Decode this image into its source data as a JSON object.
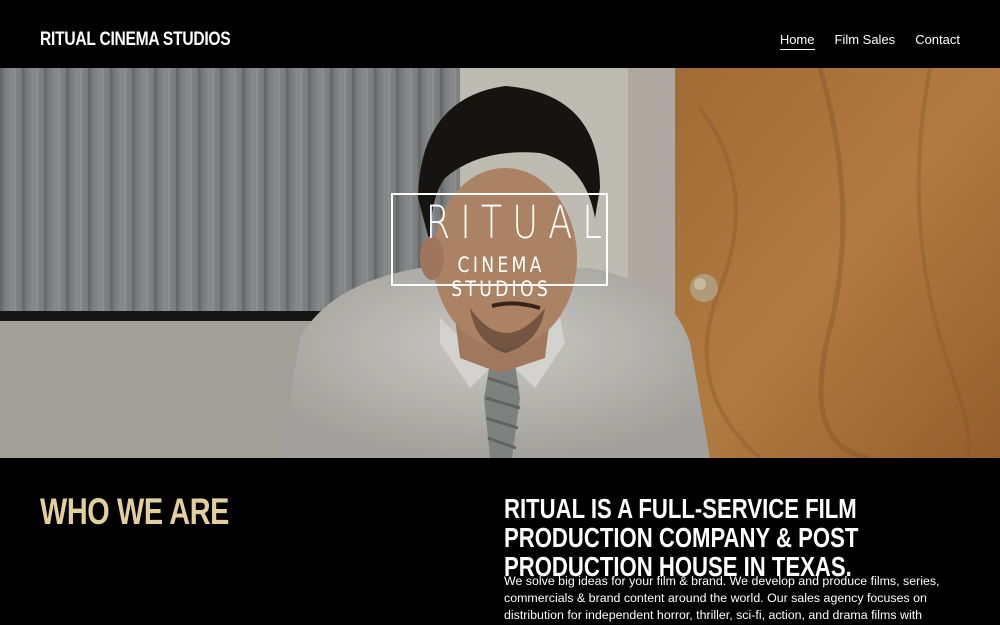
{
  "header": {
    "brand": "RITUAL CINEMA STUDIOS",
    "nav": [
      {
        "label": "Home",
        "active": true
      },
      {
        "label": "Film Sales",
        "active": false
      },
      {
        "label": "Contact",
        "active": false
      }
    ]
  },
  "hero": {
    "logo_main": "RITUAL",
    "logo_sub": "CINEMA STUDIOS"
  },
  "about": {
    "heading": "WHO WE ARE",
    "headline": "RITUAL IS A FULL-SERVICE FILM PRODUCTION COMPANY & POST PRODUCTION HOUSE IN TEXAS.",
    "body": "We solve big ideas for your film & brand. We develop and produce films, series, commercials & brand content around the world. Our sales agency focuses on distribution for independent horror, thriller, sci-fi, action, and drama films with"
  },
  "colors": {
    "accent": "#e2cf9c",
    "background": "#000000",
    "text": "#ffffff"
  }
}
